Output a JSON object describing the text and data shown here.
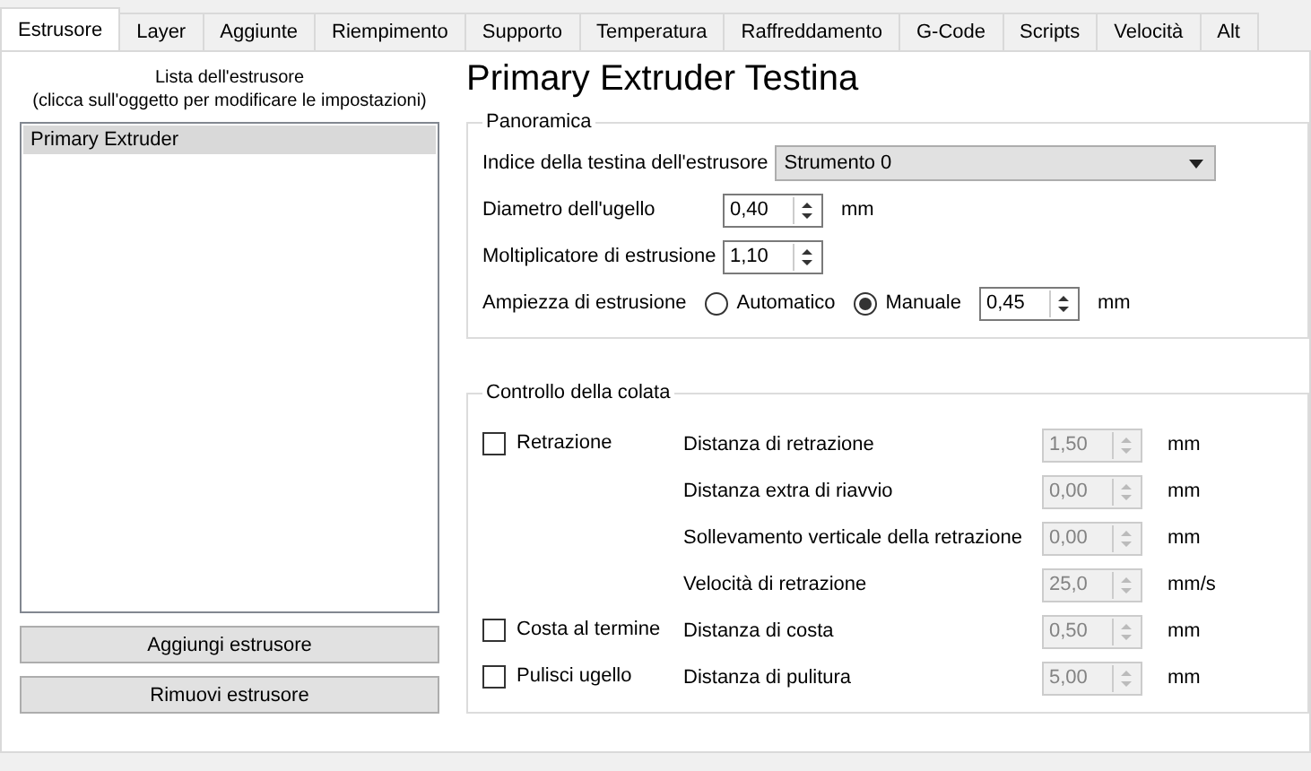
{
  "tabs": [
    {
      "label": "Estrusore",
      "selected": true
    },
    {
      "label": "Layer",
      "selected": false
    },
    {
      "label": "Aggiunte",
      "selected": false
    },
    {
      "label": "Riempimento",
      "selected": false
    },
    {
      "label": "Supporto",
      "selected": false
    },
    {
      "label": "Temperatura",
      "selected": false
    },
    {
      "label": "Raffreddamento",
      "selected": false
    },
    {
      "label": "G-Code",
      "selected": false
    },
    {
      "label": "Scripts",
      "selected": false
    },
    {
      "label": "Velocità",
      "selected": false
    },
    {
      "label": "Alt",
      "selected": false
    }
  ],
  "extruder_list": {
    "title": [
      "Lista dell'estrusore",
      "(clicca sull'oggetto per modificare le impostazioni)"
    ],
    "items": [
      {
        "label": "Primary Extruder",
        "selected": true
      }
    ],
    "buttons": [
      "Aggiungi estrusore",
      "Rimuovi estrusore"
    ]
  },
  "title": "Primary Extruder Testina",
  "overview": {
    "legend": "Panoramica",
    "index": {
      "label": "Indice della testina dell'estrusore",
      "value": "Strumento 0"
    },
    "fields": [
      {
        "label": "Diametro dell'ugello",
        "value": "0,40",
        "unit": "mm"
      },
      {
        "label": "Moltiplicatore di estrusione",
        "value": "1,10"
      }
    ],
    "width": {
      "label": "Ampiezza di estrusione",
      "options": [
        {
          "label": "Automatico",
          "selected": false
        },
        {
          "label": "Manuale",
          "selected": true
        }
      ],
      "value": "0,45",
      "unit": "mm"
    }
  },
  "flow": {
    "legend": "Controllo della colata",
    "groups": [
      {
        "checkbox": {
          "label": "Retrazione",
          "checked": false
        },
        "rows": [
          {
            "label": "Distanza di retrazione",
            "value": "1,50",
            "unit": "mm",
            "disabled": true
          },
          {
            "label": "Distanza extra di riavvio",
            "value": "0,00",
            "unit": "mm",
            "disabled": true
          },
          {
            "label": "Sollevamento verticale della retrazione",
            "value": "0,00",
            "unit": "mm",
            "disabled": true
          },
          {
            "label": "Velocità di retrazione",
            "value": "25,0",
            "unit": "mm/s",
            "disabled": true
          }
        ]
      },
      {
        "checkbox": {
          "label": "Costa al termine",
          "checked": false
        },
        "rows": [
          {
            "label": "Distanza di costa",
            "value": "0,50",
            "unit": "mm",
            "disabled": true
          }
        ]
      },
      {
        "checkbox": {
          "label": "Pulisci ugello",
          "checked": false
        },
        "rows": [
          {
            "label": "Distanza di pulitura",
            "value": "5,00",
            "unit": "mm",
            "disabled": true
          }
        ]
      }
    ]
  }
}
